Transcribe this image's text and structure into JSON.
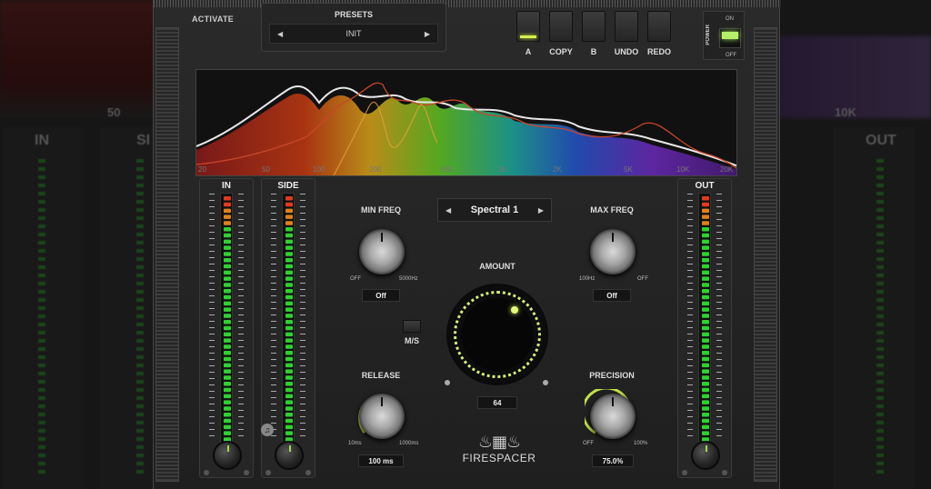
{
  "background": {
    "left_labels": [
      "IN",
      "SI",
      "50"
    ],
    "right_labels": [
      "OUT",
      "10K"
    ]
  },
  "header": {
    "activate_label": "ACTIVATE",
    "presets_label": "PRESETS",
    "preset_value": "INIT",
    "buttons": [
      {
        "label": "A",
        "lit": true
      },
      {
        "label": "COPY",
        "lit": false
      },
      {
        "label": "B",
        "lit": false
      },
      {
        "label": "UNDO",
        "lit": false
      },
      {
        "label": "REDO",
        "lit": false
      }
    ],
    "power": {
      "title": "POWER",
      "on": "ON",
      "off": "OFF"
    }
  },
  "spectrum": {
    "freq_labels": [
      "20",
      "50",
      "100",
      "200",
      "500",
      "1K",
      "2K",
      "5K",
      "10K",
      "20K"
    ]
  },
  "meters": {
    "in": "IN",
    "side": "SIDE",
    "out": "OUT"
  },
  "controls": {
    "spectral_value": "Spectral 1",
    "min_freq": {
      "label": "MIN FREQ",
      "min": "OFF",
      "max": "5000Hz",
      "value": "Off"
    },
    "max_freq": {
      "label": "MAX FREQ",
      "min": "100Hz",
      "max": "OFF",
      "value": "Off"
    },
    "amount": {
      "label": "AMOUNT",
      "value": "64"
    },
    "ms_label": "M/S",
    "release": {
      "label": "RELEASE",
      "min": "10ms",
      "max": "1000ms",
      "value": "100 ms"
    },
    "precision": {
      "label": "PRECISION",
      "min": "OFF",
      "max": "100%",
      "value": "75.0%"
    }
  },
  "logo": {
    "name": "FIRESPACER"
  },
  "colors": {
    "accent": "#d3f07a",
    "meter_green": "#2fd12f",
    "meter_red": "#e23a1a"
  }
}
